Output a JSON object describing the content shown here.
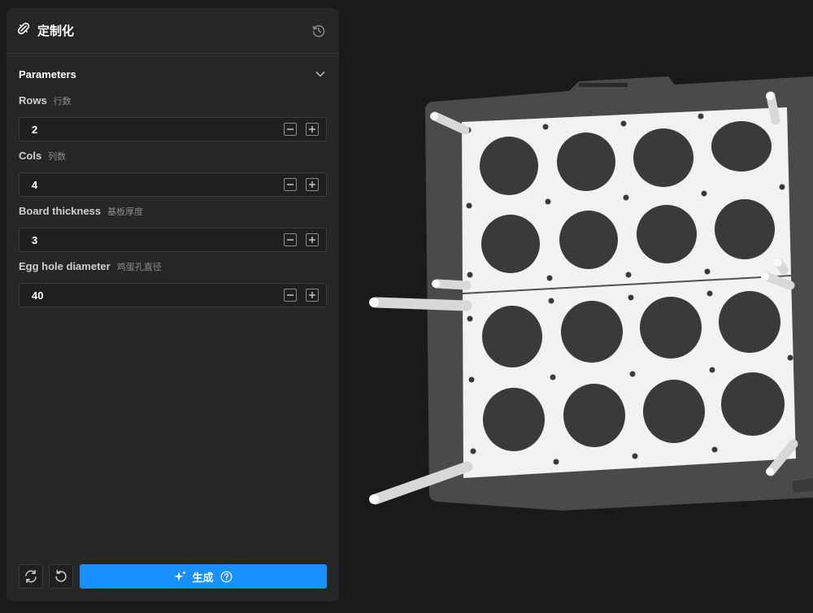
{
  "panel": {
    "title": "定制化",
    "title_icon": "wand-magic-icon",
    "history_icon": "history-icon"
  },
  "parameters": {
    "section_title": "Parameters",
    "items": [
      {
        "label": "Rows",
        "label_cn": "行数",
        "value": "2"
      },
      {
        "label": "Cols",
        "label_cn": "列数",
        "value": "4"
      },
      {
        "label": "Board thickness",
        "label_cn": "基板厚度",
        "value": "3"
      },
      {
        "label": "Egg hole diameter",
        "label_cn": "鸡蛋孔直径",
        "value": "40"
      }
    ]
  },
  "footer": {
    "refresh_icon": "refresh-icon",
    "reset_icon": "undo-icon",
    "generate_label": "生成",
    "generate_icon": "sparkle-icon",
    "help_icon": "help-circle-icon",
    "generate_color": "#1890ff"
  },
  "colors": {
    "background": "#1a1a1a",
    "panel": "#262626",
    "print_bed": "#4a4a4a",
    "model": "#f2f2f2"
  }
}
